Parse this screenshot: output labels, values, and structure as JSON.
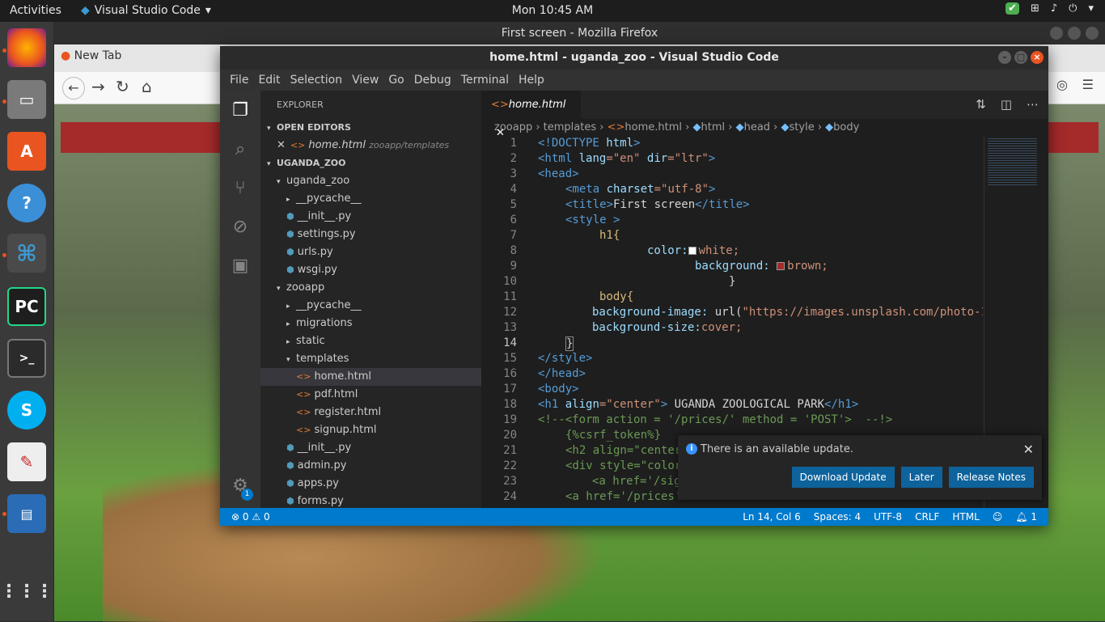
{
  "topbar": {
    "activities": "Activities",
    "app_name": "Visual Studio Code",
    "clock": "Mon 10:45 AM"
  },
  "firefox": {
    "window_title": "First screen - Mozilla Firefox",
    "tab_label": "New Tab"
  },
  "vscode": {
    "window_title": "home.html - uganda_zoo - Visual Studio Code",
    "menu": [
      "File",
      "Edit",
      "Selection",
      "View",
      "Go",
      "Debug",
      "Terminal",
      "Help"
    ],
    "explorer": {
      "header": "EXPLORER",
      "open_editors": "OPEN EDITORS",
      "open_file": "home.html",
      "open_file_path": "zooapp/templates",
      "project": "UGANDA_ZOO",
      "tree": [
        {
          "label": "uganda_zoo",
          "kind": "folder-open",
          "indent": 1
        },
        {
          "label": "__pycache__",
          "kind": "folder",
          "indent": 2
        },
        {
          "label": "__init__.py",
          "kind": "py",
          "indent": 2
        },
        {
          "label": "settings.py",
          "kind": "py",
          "indent": 2
        },
        {
          "label": "urls.py",
          "kind": "py",
          "indent": 2
        },
        {
          "label": "wsgi.py",
          "kind": "py",
          "indent": 2
        },
        {
          "label": "zooapp",
          "kind": "folder-open",
          "indent": 1
        },
        {
          "label": "__pycache__",
          "kind": "folder",
          "indent": 2
        },
        {
          "label": "migrations",
          "kind": "folder",
          "indent": 2
        },
        {
          "label": "static",
          "kind": "folder",
          "indent": 2
        },
        {
          "label": "templates",
          "kind": "folder-open",
          "indent": 2
        },
        {
          "label": "home.html",
          "kind": "html",
          "indent": 3,
          "selected": true
        },
        {
          "label": "pdf.html",
          "kind": "html",
          "indent": 3
        },
        {
          "label": "register.html",
          "kind": "html",
          "indent": 3
        },
        {
          "label": "signup.html",
          "kind": "html",
          "indent": 3
        },
        {
          "label": "__init__.py",
          "kind": "py",
          "indent": 2
        },
        {
          "label": "admin.py",
          "kind": "py",
          "indent": 2
        },
        {
          "label": "apps.py",
          "kind": "py",
          "indent": 2
        },
        {
          "label": "forms.py",
          "kind": "py",
          "indent": 2
        }
      ]
    },
    "tab": "home.html",
    "breadcrumb": [
      "zooapp",
      "templates",
      "home.html",
      "html",
      "head",
      "style",
      "body"
    ],
    "code_lines": [
      "1",
      "2",
      "3",
      "4",
      "5",
      "6",
      "7",
      "8",
      "9",
      "10",
      "11",
      "12",
      "13",
      "14",
      "15",
      "16",
      "17",
      "18",
      "19",
      "20",
      "21",
      "22",
      "23",
      "24"
    ],
    "current_line": "14",
    "code": {
      "l1a": "<!DOCTYPE ",
      "l1b": "html",
      ">": ">",
      "l2": "<html",
      "l2a": " lang",
      "l2b": "=\"en\"",
      "l2c": " dir",
      "l2d": "=\"ltr\"",
      "l2e": ">",
      "l3": "<head>",
      "l4a": "<meta",
      "l4b": " charset",
      "l4c": "=\"utf-8\"",
      "l4d": ">",
      "l5a": "<title>",
      "l5b": "First screen",
      "l5c": "</title>",
      "l6a": "<style ",
      "l6b": ">",
      "l7": "h1{",
      "l8a": "color:",
      "l8b": "white;",
      "l9a": "background: ",
      "l9b": "brown;",
      "l10": "}",
      "l11": "body{",
      "l12a": "background-image: ",
      "l12b": "url(",
      "l12c": "\"https://images.unsplash.com/photo-1",
      "l13a": "background-size:",
      "l13b": "cover;",
      "l14": "}",
      "l15": "</style>",
      "l16": "</head>",
      "l17": "<body>",
      "l18a": "<h1",
      "l18b": " align",
      "l18c": "=\"center\"",
      "l18d": ">",
      "l18e": " UGANDA ZOOLOGICAL PARK",
      "l18f": "</h1>",
      "l19": "<!--<form action = '/prices/' method = 'POST'>  --!>",
      "l20": "{%csrf_token%}",
      "l21": "<h2 align=\"center",
      "l22": "<div style=\"color",
      "l23": "<a href='/sig",
      "l24": "<a href='/prices'"
    },
    "notification": {
      "message": "There is an available update.",
      "buttons": [
        "Download Update",
        "Later",
        "Release Notes"
      ]
    },
    "status": {
      "errors": "0",
      "warnings": "0",
      "position": "Ln 14, Col 6",
      "spaces": "Spaces: 4",
      "encoding": "UTF-8",
      "eol": "CRLF",
      "language": "HTML",
      "bell": "1"
    },
    "settings_badge": "1"
  }
}
